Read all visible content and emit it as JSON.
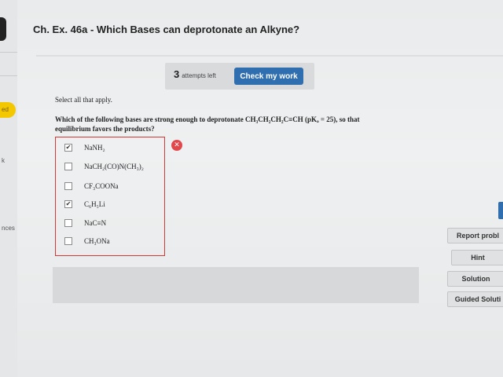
{
  "title": "Ch. Ex. 46a - Which Bases can deprotonate an Alkyne?",
  "attempts": {
    "count": "3",
    "text": "attempts left"
  },
  "check_label": "Check my work",
  "instructions": "Select all that apply.",
  "question": {
    "line1": "Which of the following bases are strong enough to deprotonate CH₃CH₂CH₂C≡CH (pKₐ = 25), so that",
    "line2": "equilibrium favors the products?"
  },
  "choices": [
    {
      "label": "NaNH₂",
      "checked": true,
      "mark": "✔"
    },
    {
      "label": "NaCH₂(CO)N(CH₃)₂",
      "checked": false,
      "mark": ""
    },
    {
      "label": "CF₃COONa",
      "checked": false,
      "mark": ""
    },
    {
      "label": "C₆H₅Li",
      "checked": true,
      "mark": "✔"
    },
    {
      "label": "NaC≡N",
      "checked": false,
      "mark": ""
    },
    {
      "label": "CH₃ONa",
      "checked": false,
      "mark": ""
    }
  ],
  "incorrect_icon": "✕",
  "side": {
    "report": "Report probl",
    "hint": "Hint",
    "solution": "Solution",
    "guided": "Guided Soluti"
  },
  "left_fragments": {
    "badge": "ed",
    "k": "k",
    "ces": "nces"
  },
  "colors": {
    "accent": "#2f6fb0",
    "error": "#d23a3a"
  }
}
